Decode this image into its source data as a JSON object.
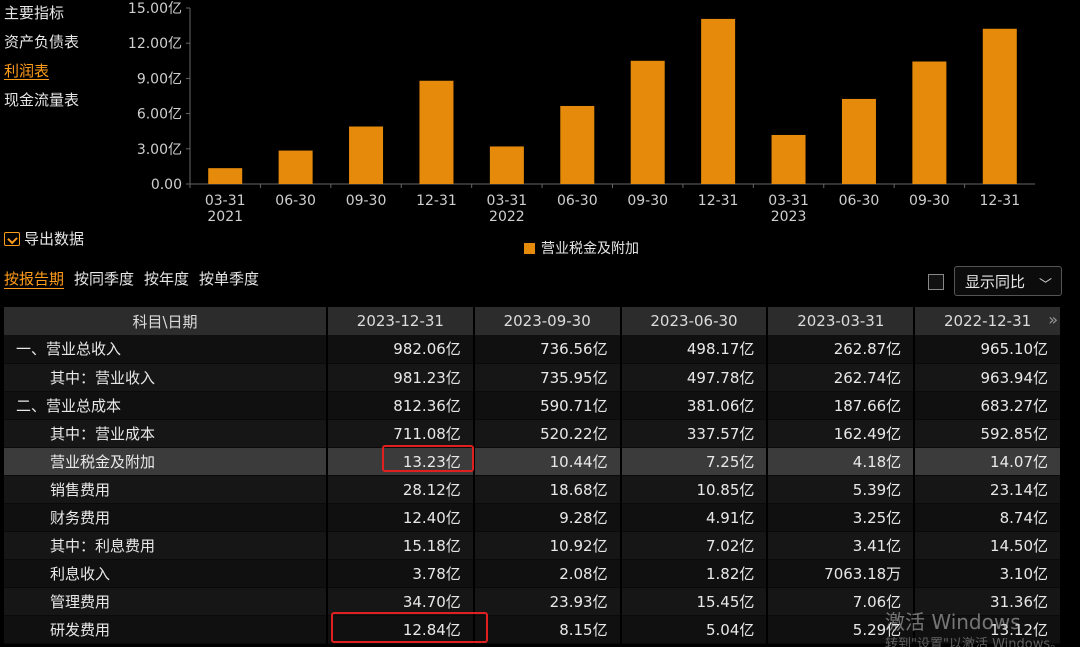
{
  "nav": {
    "items": [
      "主要指标",
      "资产负债表",
      "利润表",
      "现金流量表"
    ],
    "active_index": 2
  },
  "chart_data": {
    "type": "bar",
    "categories": [
      "03-31\n2021",
      "06-30",
      "09-30",
      "12-31",
      "03-31\n2022",
      "06-30",
      "09-30",
      "12-31",
      "03-31\n2023",
      "06-30",
      "09-30",
      "12-31"
    ],
    "values": [
      1.35,
      2.85,
      4.9,
      8.8,
      3.2,
      6.65,
      10.5,
      14.07,
      4.18,
      7.25,
      10.44,
      13.23
    ],
    "ylim": [
      0,
      15
    ],
    "yticks": [
      "0.00",
      "3.00亿",
      "6.00亿",
      "9.00亿",
      "12.00亿",
      "15.00亿"
    ],
    "legend": "营业税金及附加",
    "bar_color": "#e58a0b"
  },
  "export_label": "导出数据",
  "period_tabs": [
    "按报告期",
    "按同季度",
    "按年度",
    "按单季度"
  ],
  "yoy_select": "显示同比",
  "table": {
    "header": [
      "科目\\日期",
      "2023-12-31",
      "2023-09-30",
      "2023-06-30",
      "2023-03-31",
      "2022-12-31"
    ],
    "rows": [
      {
        "label": "一、营业总收入",
        "indent": false,
        "values": [
          "982.06亿",
          "736.56亿",
          "498.17亿",
          "262.87亿",
          "965.10亿"
        ]
      },
      {
        "label": "其中：营业收入",
        "indent": true,
        "values": [
          "981.23亿",
          "735.95亿",
          "497.78亿",
          "262.74亿",
          "963.94亿"
        ]
      },
      {
        "label": "二、营业总成本",
        "indent": false,
        "values": [
          "812.36亿",
          "590.71亿",
          "381.06亿",
          "187.66亿",
          "683.27亿"
        ]
      },
      {
        "label": "其中：营业成本",
        "indent": true,
        "values": [
          "711.08亿",
          "520.22亿",
          "337.57亿",
          "162.49亿",
          "592.85亿"
        ]
      },
      {
        "label": "营业税金及附加",
        "indent": true,
        "values": [
          "13.23亿",
          "10.44亿",
          "7.25亿",
          "4.18亿",
          "14.07亿"
        ]
      },
      {
        "label": "销售费用",
        "indent": true,
        "values": [
          "28.12亿",
          "18.68亿",
          "10.85亿",
          "5.39亿",
          "23.14亿"
        ]
      },
      {
        "label": "财务费用",
        "indent": true,
        "values": [
          "12.40亿",
          "9.28亿",
          "4.91亿",
          "3.25亿",
          "8.74亿"
        ]
      },
      {
        "label": "其中：利息费用",
        "indent": true,
        "values": [
          "15.18亿",
          "10.92亿",
          "7.02亿",
          "3.41亿",
          "14.50亿"
        ]
      },
      {
        "label": "利息收入",
        "indent": true,
        "values": [
          "3.78亿",
          "2.08亿",
          "1.82亿",
          "7063.18万",
          "3.10亿"
        ]
      },
      {
        "label": "管理费用",
        "indent": true,
        "values": [
          "34.70亿",
          "23.93亿",
          "15.45亿",
          "7.06亿",
          "31.36亿"
        ]
      },
      {
        "label": "研发费用",
        "indent": true,
        "values": [
          "12.84亿",
          "8.15亿",
          "5.04亿",
          "5.29亿",
          "13.12亿"
        ]
      }
    ],
    "highlight_row": 4
  },
  "watermark": {
    "line1": "激活 Windows",
    "line2": "转到\"设置\"以激活 Windows。"
  }
}
